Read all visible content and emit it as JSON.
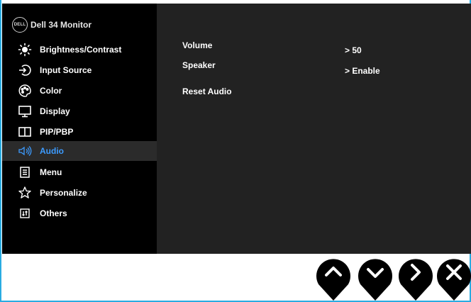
{
  "osd": {
    "brand_logo": "DELL",
    "brand_title": "Dell 34 Monitor",
    "menu": [
      {
        "label": "Brightness/Contrast",
        "icon": "brightness-icon"
      },
      {
        "label": "Input Source",
        "icon": "input-source-icon"
      },
      {
        "label": "Color",
        "icon": "color-palette-icon"
      },
      {
        "label": "Display",
        "icon": "display-icon"
      },
      {
        "label": "PIP/PBP",
        "icon": "pip-pbp-icon"
      },
      {
        "label": "Audio",
        "icon": "speaker-icon",
        "active": true
      },
      {
        "label": "Menu",
        "icon": "menu-list-icon"
      },
      {
        "label": "Personalize",
        "icon": "star-icon"
      },
      {
        "label": "Others",
        "icon": "others-icon"
      }
    ],
    "audio_settings": [
      {
        "label": "Volume",
        "value": "> 50"
      },
      {
        "label": "Speaker",
        "value": "> Enable"
      },
      {
        "label": "Reset Audio",
        "value": ""
      }
    ]
  },
  "controls": [
    {
      "name": "up-button",
      "icon": "chevron-up-icon"
    },
    {
      "name": "down-button",
      "icon": "chevron-down-icon"
    },
    {
      "name": "next-button",
      "icon": "chevron-right-icon"
    },
    {
      "name": "exit-button",
      "icon": "close-icon"
    }
  ],
  "colors": {
    "accent": "#3c9bff",
    "osd_bg": "#222222",
    "sidebar_bg": "#000000",
    "frame": "#29abe2"
  }
}
